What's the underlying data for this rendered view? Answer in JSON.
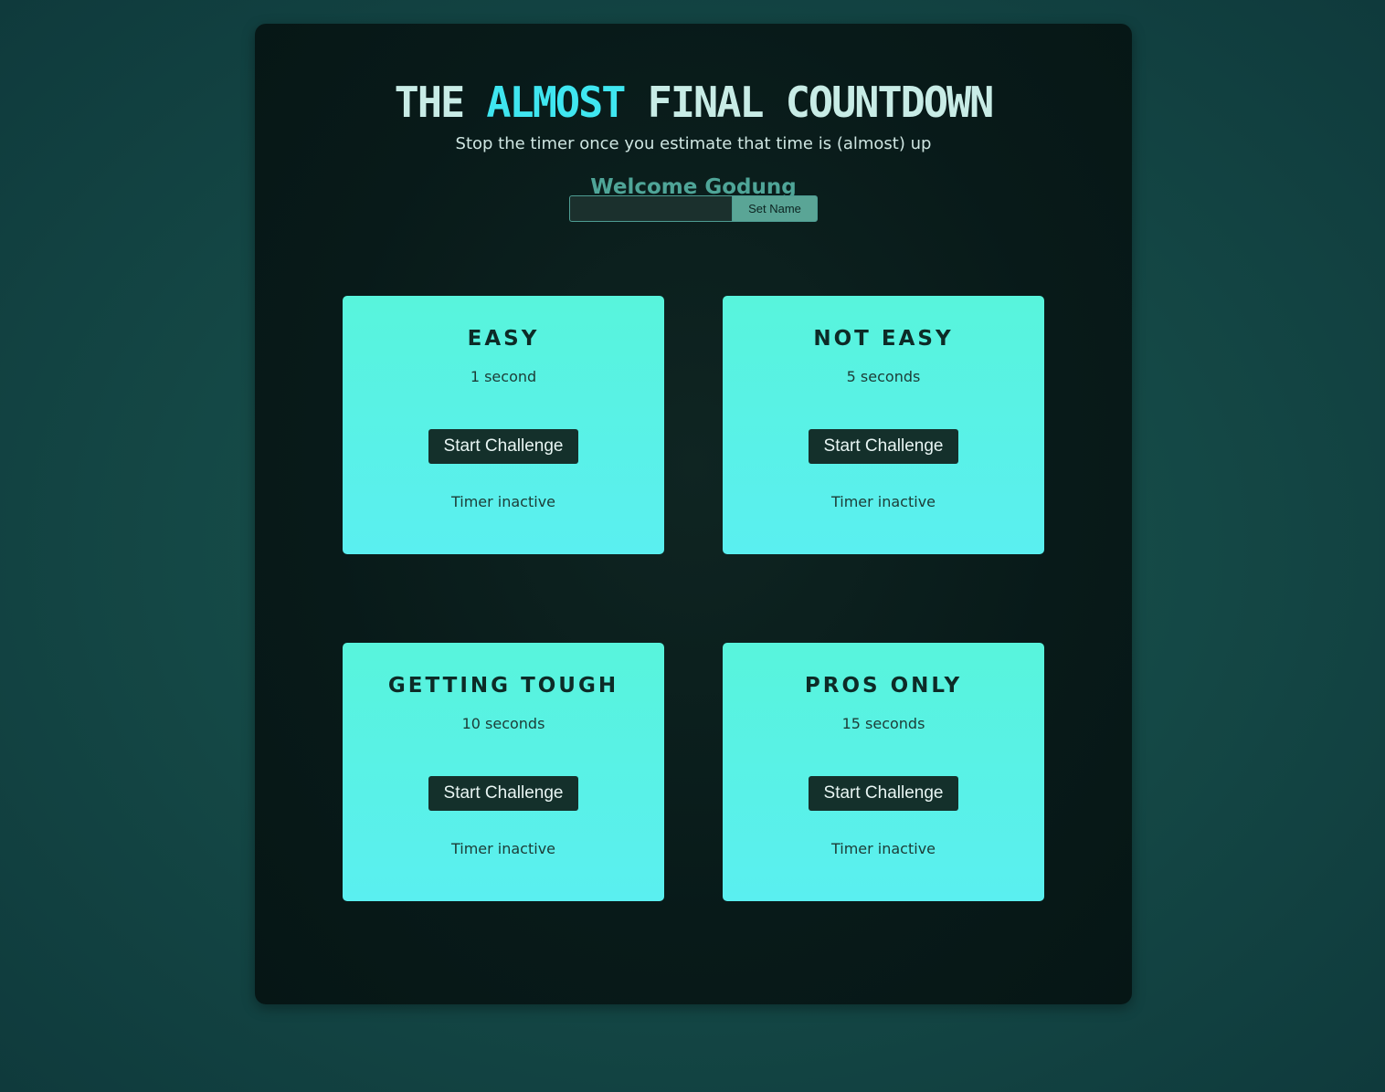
{
  "header": {
    "title_part1": "THE",
    "title_accent": "ALMOST",
    "title_part2": "FINAL COUNTDOWN",
    "subtitle": "Stop the timer once you estimate that time is (almost) up"
  },
  "player": {
    "welcome_text": "Welcome Godung",
    "name_input_value": "",
    "set_name_label": "Set Name"
  },
  "challenges": [
    {
      "title": "EASY",
      "duration": "1 second",
      "button_label": "Start Challenge",
      "status": "Timer inactive"
    },
    {
      "title": "NOT EASY",
      "duration": "5 seconds",
      "button_label": "Start Challenge",
      "status": "Timer inactive"
    },
    {
      "title": "GETTING TOUGH",
      "duration": "10 seconds",
      "button_label": "Start Challenge",
      "status": "Timer inactive"
    },
    {
      "title": "PROS ONLY",
      "duration": "15 seconds",
      "button_label": "Start Challenge",
      "status": "Timer inactive"
    }
  ],
  "colors": {
    "page_background": "#154a47",
    "panel_background": "#081a19",
    "title_text": "#c8ece6",
    "title_accent": "#3fe6f0",
    "welcome_text": "#4fa598",
    "card_gradient_top": "#58f4dc",
    "card_gradient_bottom": "#5aeff0",
    "button_background": "#14302b",
    "set_name_button": "#5aa596"
  }
}
